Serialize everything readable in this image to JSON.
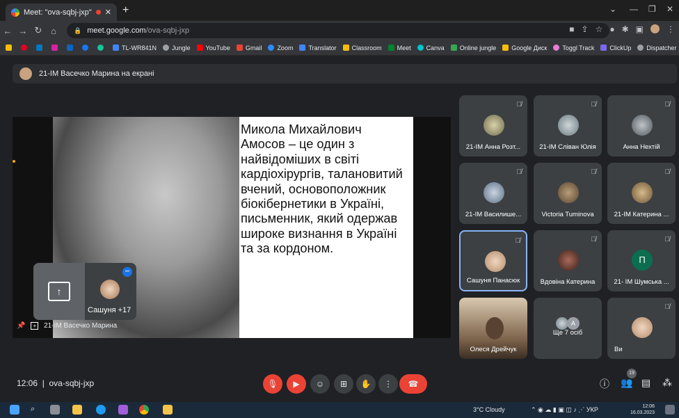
{
  "browser": {
    "tab_title": "Meet: \"ova-sqbj-jxp\"",
    "new_tab_label": "+",
    "url_host": "meet.google.com",
    "url_path": "/ova-sqbj-jxp",
    "bookmarks": [
      "TL-WR841N",
      "Jungle",
      "YouTube",
      "Gmail",
      "Zoom",
      "Translator",
      "Classroom",
      "Meet",
      "Canva",
      "Online jungle",
      "Google Диск",
      "Toggl Track",
      "ClickUp",
      "Dispatcher"
    ]
  },
  "meet": {
    "presenting_banner": "21-IM Васечко Марина на екрані",
    "slide_text": "Микола Михайлович Амосов – це один з найвідоміших в світі кардіохірургів, талановитий вчений, основоположник біокібернетики в Україні, письменник, який одержав широке визнання в Україні та за кордоном.",
    "self_name": "Сашуня",
    "self_extra": "+17",
    "stage_name": "21-IM Васечко Марина",
    "tiles": [
      {
        "name": "21-IM Анна Розт..."
      },
      {
        "name": "21-IM Сліван Юлія"
      },
      {
        "name": "Анна Нехтій"
      },
      {
        "name": "21-IM Василише..."
      },
      {
        "name": "Victoria Tuminova"
      },
      {
        "name": "21-IM Катерина ..."
      },
      {
        "name": "Сашуня Панасюк"
      },
      {
        "name": "Вдовіна Катерина"
      },
      {
        "name": "21- IM Шумська ...",
        "initial": "П"
      },
      {
        "name": "Олеся Дрейчук"
      },
      {
        "name": "Ще 7 осіб",
        "initial": "A"
      },
      {
        "name": "Ви"
      }
    ],
    "clock": "12:06",
    "meeting_code": "ova-sqbj-jxp",
    "participant_count": "19"
  },
  "taskbar": {
    "weather": "3°C  Cloudy",
    "lang": "УКР",
    "time": "12:06",
    "date": "16.03.2023"
  },
  "colors": {
    "end_call": "#ea4335",
    "accent": "#8ab4f8"
  }
}
